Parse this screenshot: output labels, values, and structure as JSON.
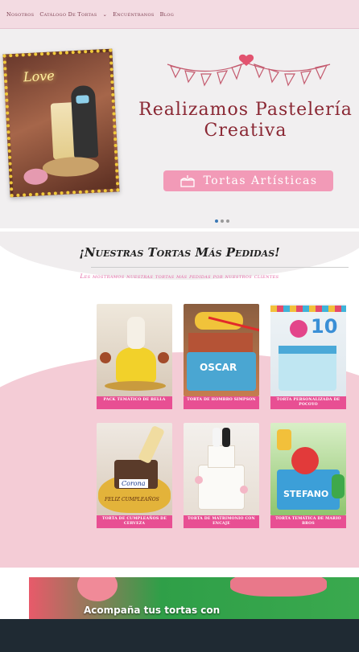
{
  "nav": {
    "items": [
      "Nosotros",
      "Catálogo De Tortas",
      "Encuéntranos",
      "Blog"
    ],
    "caret": "⌄"
  },
  "hero": {
    "photo_neon": "Love",
    "title_line1": "Realizamos Pastelería",
    "title_line2": "Creativa",
    "badge_label": "Tortas Artísticas",
    "slides": 3,
    "active_slide": 1
  },
  "section": {
    "title": "¡Nuestras Tortas Más Pedidas!",
    "subtitle": "Les mostramos nuestras tortas más pedidas por nuestros clientes",
    "cards": [
      {
        "caption": "PACK TEMÁTICO DE BELLA"
      },
      {
        "caption": "TORTA DE HOMBRO SIMPSON"
      },
      {
        "caption": "TORTA PERSONALIZADA DE POCOYO"
      },
      {
        "caption": "TORTA DE CUMPLEAÑOS DE CERVEZA"
      },
      {
        "caption": "TORTA DE MATRIMONIO CON ENCAJE"
      },
      {
        "caption": "TORTA TEMÁTICA DE MARIO BROS"
      }
    ],
    "card_texts": {
      "oscar": "OSCAR",
      "corona": "Corona",
      "cumple": "FELIZ CUMPLEAÑOS",
      "stefano": "STEFANO",
      "num10": "10"
    }
  },
  "banner": {
    "text": "Acompaña tus tortas con"
  },
  "colors": {
    "nav_bg": "#f3dbe2",
    "accent_pink": "#e84f93",
    "title_red": "#8a2733",
    "badge_pink": "#f29ab7",
    "footer": "#1f2a33"
  }
}
